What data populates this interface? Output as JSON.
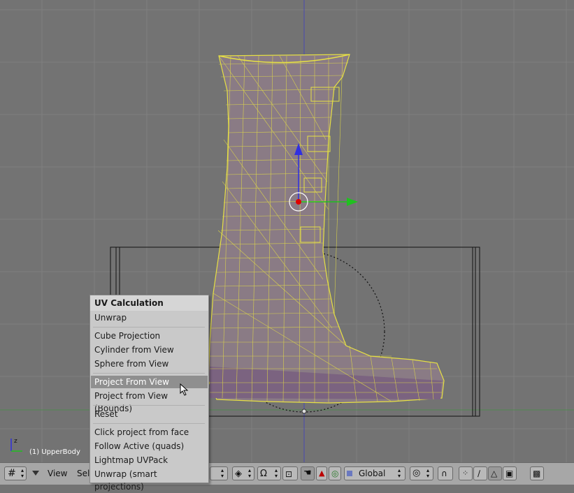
{
  "viewport": {
    "object_label": "(1) UpperBody",
    "colors": {
      "background": "#737373",
      "grid": "#7e7e7e",
      "wire": "#e6e044",
      "mesh_fill": "#7e6a7e"
    }
  },
  "uv_menu": {
    "title": "UV Calculation",
    "items": [
      "Unwrap",
      "Cube Projection",
      "Cylinder from View",
      "Sphere from View",
      "Project From View",
      "Project from View (Bounds)",
      "Reset",
      "Click project from face",
      "Follow Active (quads)",
      "Lightmap UVPack",
      "Unwrap (smart projections)"
    ],
    "highlighted": "Project From View"
  },
  "header": {
    "view_menu": "View",
    "select_menu": "Sel",
    "orientation": "Global",
    "icons": [
      "editor-type-icon",
      "menu-collapse-icon",
      "pivot-icon",
      "snap-icon",
      "hand-icon",
      "translate-icon",
      "rotate-icon",
      "orientation-icon",
      "proportional-icon",
      "magnet-icon",
      "vertex-select-icon",
      "edge-select-icon",
      "face-select-icon",
      "limit-visible-icon",
      "render-icon"
    ]
  }
}
